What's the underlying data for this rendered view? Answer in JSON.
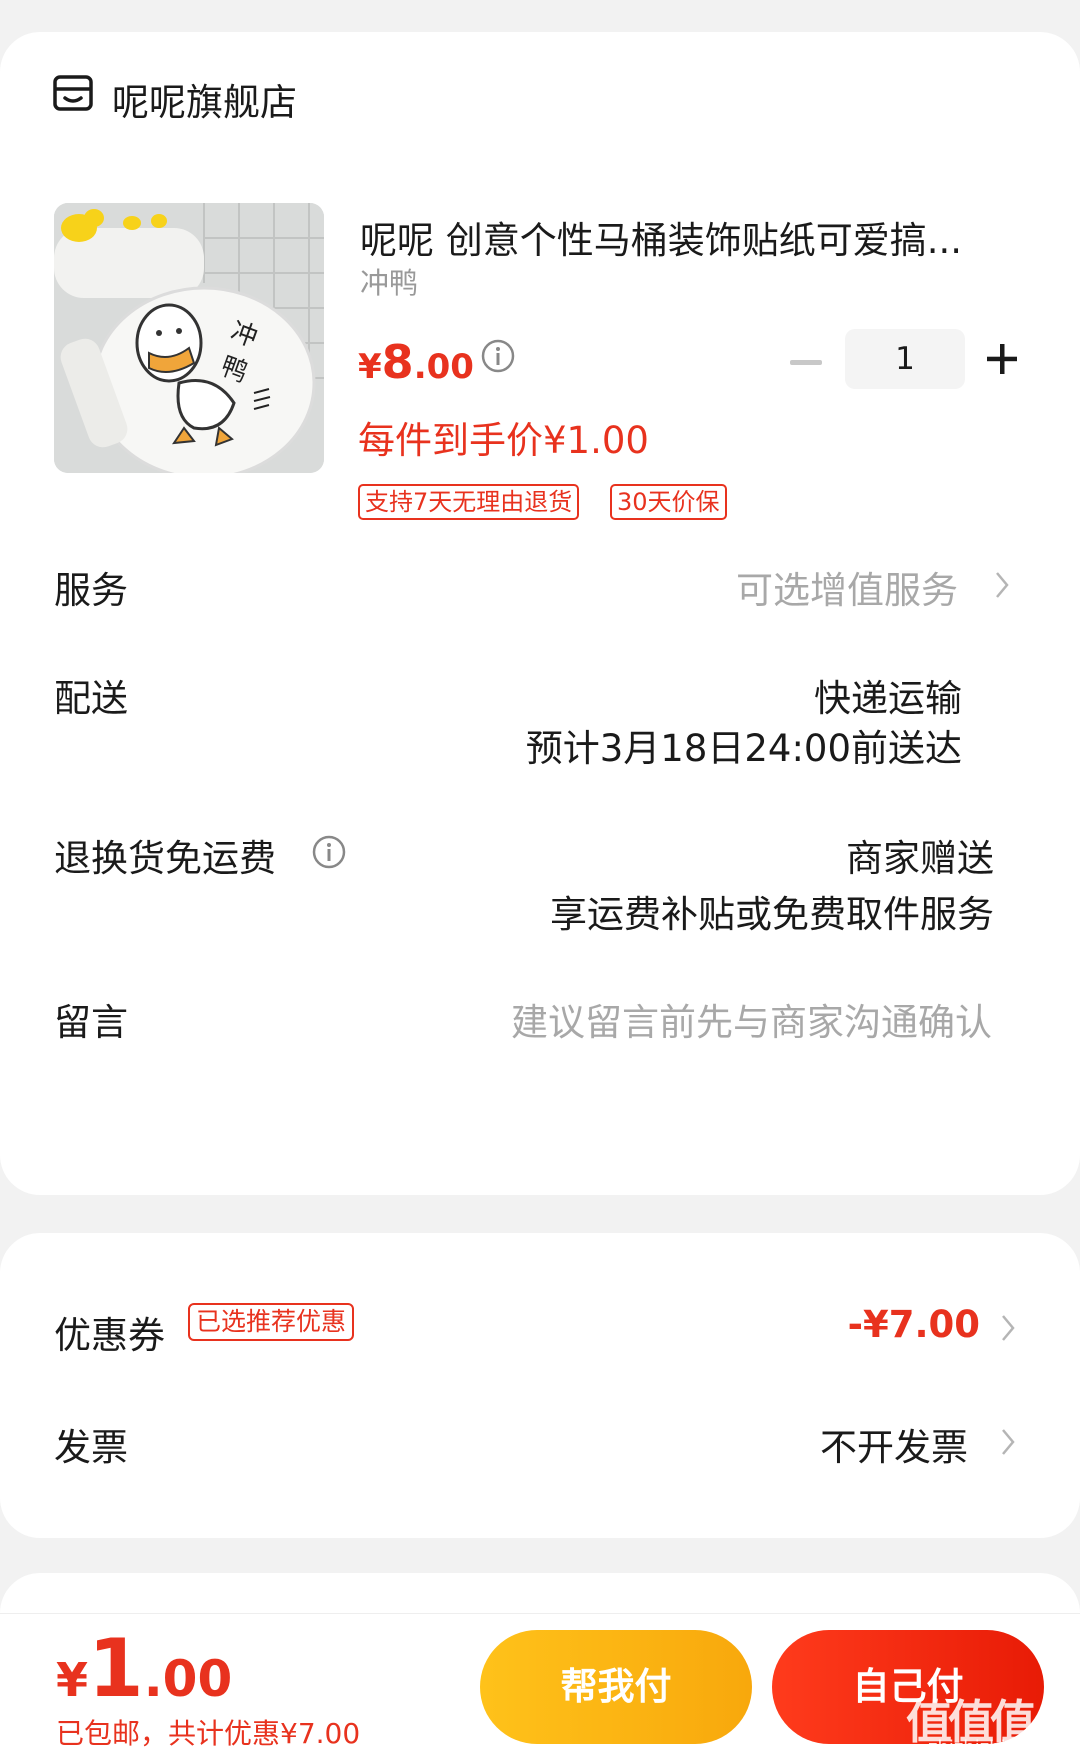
{
  "store": {
    "name": "呢呢旗舰店",
    "icon": "store-icon"
  },
  "product": {
    "title": "呢呢 创意个性马桶装饰贴纸可爱搞...",
    "variant": "冲鸭",
    "price_currency": "¥",
    "price_integer": "8",
    "price_decimal": ".00",
    "unit_price": "每件到手价¥1.00",
    "tags": [
      "支持7天无理由退货",
      "30天价保"
    ],
    "quantity": "1",
    "image_text": "冲鸭"
  },
  "rows": {
    "service_label": "服务",
    "service_value": "可选增值服务",
    "delivery_label": "配送",
    "delivery_method": "快递运输",
    "delivery_eta": "预计3月18日24:00前送达",
    "return_label": "退换货免运费",
    "return_value": "商家赠送",
    "return_detail": "享运费补贴或免费取件服务",
    "message_label": "留言",
    "message_placeholder": "建议留言前先与商家沟通确认"
  },
  "discount": {
    "coupon_label": "优惠券",
    "coupon_badge": "已选推荐优惠",
    "coupon_value": "-¥7.00",
    "invoice_label": "发票",
    "invoice_value": "不开发票"
  },
  "footer": {
    "total_currency": "¥",
    "total_integer": "1",
    "total_decimal": ".00",
    "summary": "已包邮，共计优惠¥7.00",
    "help_pay_label": "帮我付",
    "self_pay_label": "自己付"
  },
  "watermark": {
    "text": "值值值",
    "url": "zhizhizhi.com"
  },
  "colors": {
    "accent": "#e8321e",
    "help_button": "#f8b014",
    "muted": "#a8a8a8"
  }
}
